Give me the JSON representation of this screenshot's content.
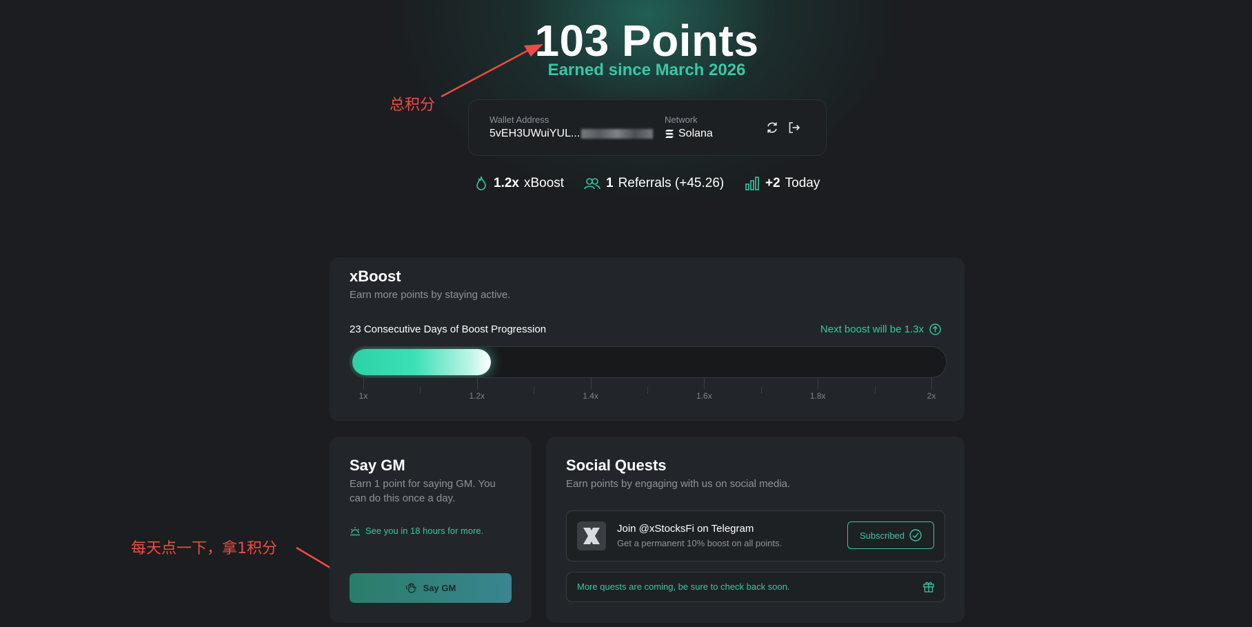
{
  "hero": {
    "points": "103 Points",
    "subtitle": "Earned since March 2026"
  },
  "annotations": {
    "total_points": "总积分",
    "daily_click": "每天点一下，拿1积分"
  },
  "wallet": {
    "address_label": "Wallet Address",
    "address_value": "5vEH3UWuiYUL...",
    "network_label": "Network",
    "network_value": "Solana",
    "refresh_icon": "refresh-icon",
    "logout_icon": "logout-icon"
  },
  "stats": {
    "boost_value": "1.2x",
    "boost_label": "xBoost",
    "referrals_value": "1",
    "referrals_label": "Referrals (+45.26)",
    "today_value": "+2",
    "today_label": "Today"
  },
  "xboost": {
    "title": "xBoost",
    "description": "Earn more points by staying active.",
    "progress_label": "23 Consecutive Days of Boost Progression",
    "next_boost": "Next boost will be 1.3x",
    "current_multiplier": 1.2,
    "scale_min": 1,
    "scale_max": 2,
    "tick_labels": [
      "1x",
      "1.2x",
      "1.4x",
      "1.6x",
      "1.8x",
      "2x"
    ]
  },
  "say_gm": {
    "title": "Say GM",
    "description": "Earn 1 point for saying GM. You can do this once a day.",
    "hint": "See you in 18 hours for more.",
    "button_label": "Say GM"
  },
  "social_quests": {
    "title": "Social Quests",
    "description": "Earn points by engaging with us on social media.",
    "quest_title": "Join @xStocksFi on Telegram",
    "quest_subtitle": "Get a permanent 10% boost on all points.",
    "quest_button": "Subscribed",
    "more_text": "More quests are coming, be sure to check back soon."
  },
  "colors": {
    "accent": "#37c8a5",
    "background": "#1b1d20",
    "card": "#22262a",
    "annotation": "#ef4b45"
  }
}
